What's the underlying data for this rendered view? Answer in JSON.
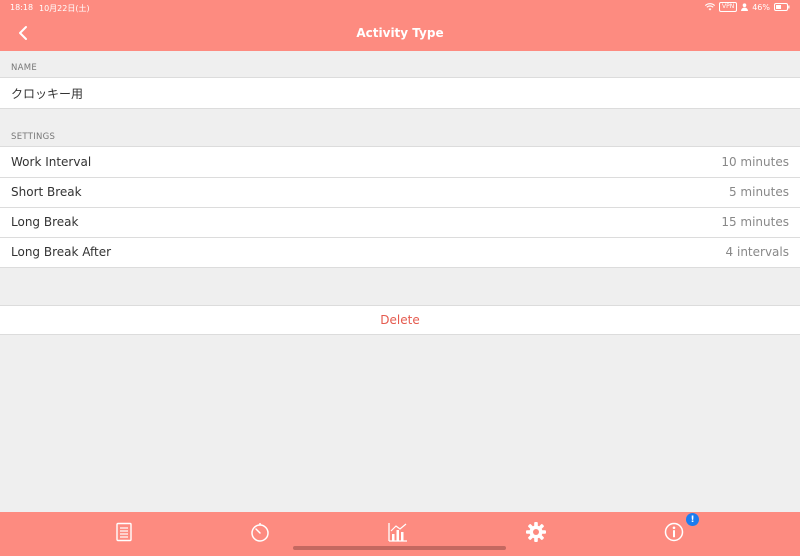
{
  "status_bar": {
    "time": "18:18",
    "date": "10月22日(土)",
    "vpn": "VPN",
    "battery": "46%"
  },
  "nav": {
    "title": "Activity Type",
    "back_icon": "chevron-left-icon"
  },
  "name_section": {
    "header": "NAME",
    "value": "クロッキー用"
  },
  "settings_section": {
    "header": "SETTINGS",
    "rows": [
      {
        "label": "Work Interval",
        "value": "10 minutes"
      },
      {
        "label": "Short Break",
        "value": "5 minutes"
      },
      {
        "label": "Long Break",
        "value": "15 minutes"
      },
      {
        "label": "Long Break After",
        "value": "4 intervals"
      }
    ]
  },
  "delete_label": "Delete",
  "tabbar": {
    "tabs": [
      "list-icon",
      "timer-icon",
      "stats-icon",
      "gear-icon",
      "info-icon"
    ],
    "active_tab": "gear-icon",
    "badge": "!"
  },
  "colors": {
    "accent": "#fd8b80",
    "delete": "#e55a4e",
    "badge": "#1c7cf0",
    "background": "#efefef"
  }
}
